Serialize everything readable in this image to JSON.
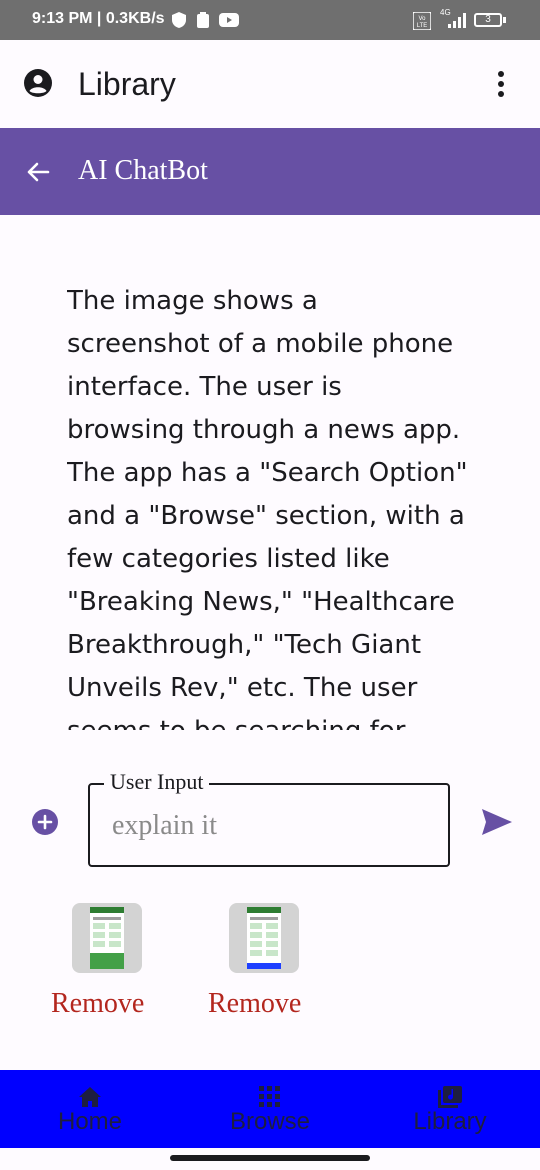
{
  "status_bar": {
    "time_speed": "9:13 PM | 0.3KB/s",
    "network": "4G",
    "battery": "3"
  },
  "app_bar": {
    "title": "Library"
  },
  "chat_bar": {
    "title": "AI ChatBot"
  },
  "chat": {
    "response_text": "The image shows a\nscreenshot of a mobile phone\ninterface. The user is\nbrowsing through a news app.\nThe app has a \"Search Option\"\nand a \"Browse\" section, with a\nfew categories listed like\n\"Breaking News,\" \"Healthcare\nBreakthrough,\" \"Tech Giant\nUnveils Rev,\" etc. The user\nseems to be searching for"
  },
  "input": {
    "label": "User Input",
    "value": "",
    "placeholder": "explain it"
  },
  "attachments": [
    {
      "remove_label": "Remove"
    },
    {
      "remove_label": "Remove"
    }
  ],
  "bottom_nav": [
    {
      "label": "Home",
      "icon": "home-icon"
    },
    {
      "label": "Browse",
      "icon": "grid-icon"
    },
    {
      "label": "Library",
      "icon": "library-icon"
    }
  ],
  "colors": {
    "primary": "#6750a4",
    "nav_bg": "#0000ff",
    "remove": "#b3261e"
  }
}
